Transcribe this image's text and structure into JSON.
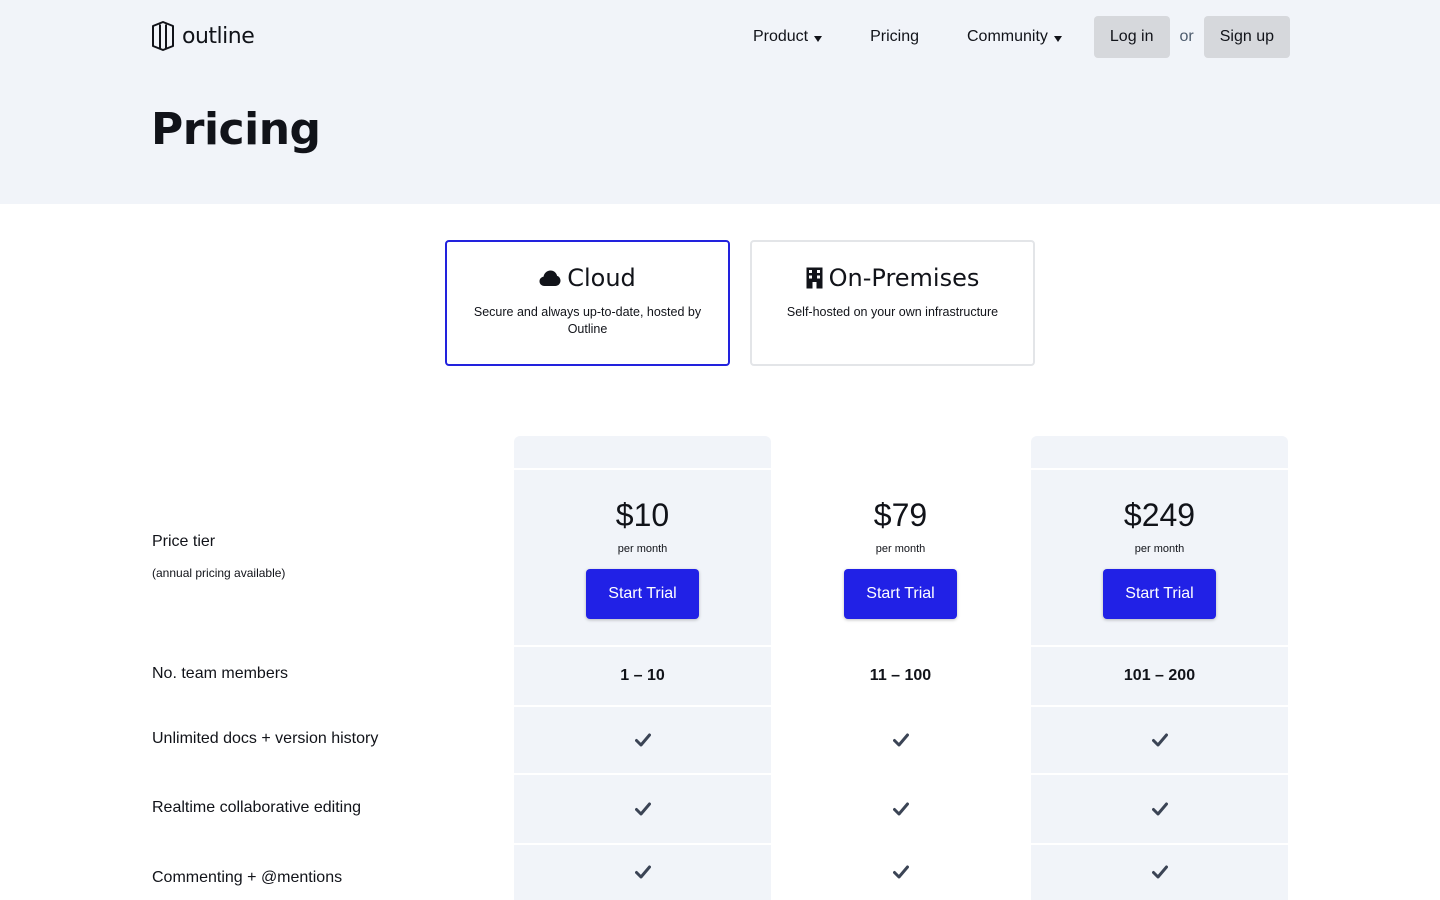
{
  "brand": {
    "name": "outline"
  },
  "nav": {
    "product": "Product",
    "pricing": "Pricing",
    "community": "Community",
    "login": "Log in",
    "or": "or",
    "signup": "Sign up"
  },
  "page": {
    "title": "Pricing"
  },
  "options": [
    {
      "title": "Cloud",
      "description": "Secure and always up-to-date, hosted by Outline",
      "icon": "cloud-icon",
      "selected": true
    },
    {
      "title": "On-Premises",
      "description": "Self-hosted on your own infrastructure",
      "icon": "building-icon",
      "selected": false
    }
  ],
  "table": {
    "rows": {
      "price_tier": "Price tier",
      "price_tier_note": "(annual pricing available)",
      "team_members": "No. team members",
      "unlimited_docs": "Unlimited docs + version history",
      "realtime": "Realtime collaborative editing",
      "commenting": "Commenting + @mentions"
    },
    "plans": [
      {
        "price": "$10",
        "period": "per month",
        "cta": "Start Trial",
        "team": "1 – 10"
      },
      {
        "price": "$79",
        "period": "per month",
        "cta": "Start Trial",
        "team": "11 – 100"
      },
      {
        "price": "$249",
        "period": "per month",
        "cta": "Start Trial",
        "team": "101 – 200"
      }
    ]
  },
  "colors": {
    "accent": "#2121e6",
    "hero_bg": "#f1f4f9",
    "selected_border": "#2222dd",
    "check": "#3b4455"
  }
}
